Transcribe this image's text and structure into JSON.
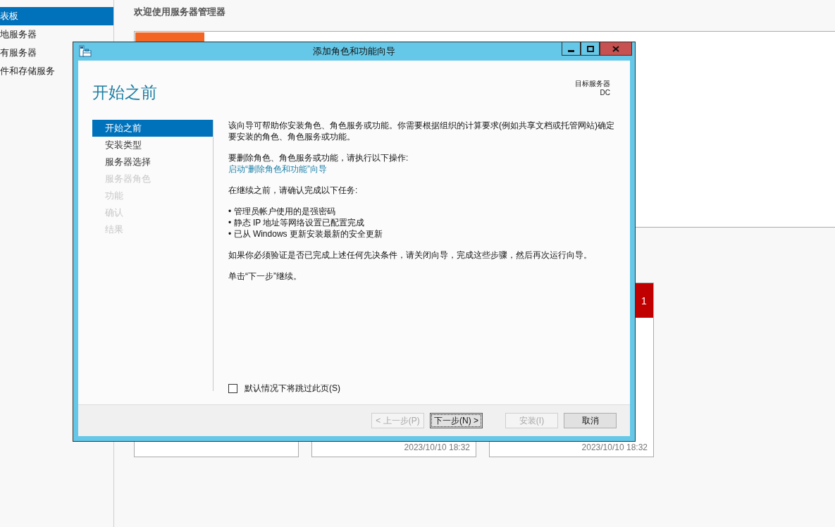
{
  "sidebar": {
    "items": [
      {
        "label": "表板",
        "selected": true
      },
      {
        "label": "地服务器",
        "selected": false
      },
      {
        "label": "有服务器",
        "selected": false
      },
      {
        "label": "件和存储服务",
        "selected": false
      }
    ]
  },
  "header": "欢迎使用服务器管理器",
  "cards": [
    {
      "kind": "plain"
    },
    {
      "kind": "plain",
      "timestamp": "2023/10/10 18:32"
    },
    {
      "kind": "alert",
      "badge": "1",
      "timestamp": "2023/10/10 18:32"
    }
  ],
  "dialog": {
    "title": "添加角色和功能向导",
    "heading": "开始之前",
    "target_server": {
      "label": "目标服务器",
      "name": "DC"
    },
    "steps": [
      {
        "label": "开始之前",
        "selected": true,
        "disabled": false
      },
      {
        "label": "安装类型",
        "selected": false,
        "disabled": false
      },
      {
        "label": "服务器选择",
        "selected": false,
        "disabled": false
      },
      {
        "label": "服务器角色",
        "selected": false,
        "disabled": true
      },
      {
        "label": "功能",
        "selected": false,
        "disabled": true
      },
      {
        "label": "确认",
        "selected": false,
        "disabled": true
      },
      {
        "label": "结果",
        "selected": false,
        "disabled": true
      }
    ],
    "blocks": [
      {
        "kind": "paragraph",
        "text": "该向导可帮助你安装角色、角色服务或功能。你需要根据组织的计算要求(例如共享文档或托管网站)确定要安装的角色、角色服务或功能。"
      },
      {
        "kind": "paragraph",
        "text": "要删除角色、角色服务或功能，请执行以下操作:",
        "link": "启动“删除角色和功能”向导"
      },
      {
        "kind": "paragraph",
        "text": "在继续之前，请确认完成以下任务:"
      },
      {
        "kind": "bullets",
        "marker": "•",
        "items": [
          "管理员帐户使用的是强密码",
          "静态 IP 地址等网络设置已配置完成",
          "已从 Windows 更新安装最新的安全更新"
        ]
      },
      {
        "kind": "paragraph",
        "text": "如果你必须验证是否已完成上述任何先决条件，请关闭向导，完成这些步骤，然后再次运行向导。"
      },
      {
        "kind": "paragraph",
        "text": "单击“下一步”继续。"
      }
    ],
    "skip_checkbox": {
      "label": "默认情况下将跳过此页(S)",
      "checked": false
    },
    "buttons": [
      {
        "label": "< 上一步(P)",
        "disabled": true,
        "focused": false
      },
      {
        "label": "下一步(N) >",
        "disabled": false,
        "focused": true
      },
      {
        "label": "安装(I)",
        "disabled": true,
        "focused": false
      },
      {
        "label": "取消",
        "disabled": false,
        "focused": false
      }
    ]
  }
}
